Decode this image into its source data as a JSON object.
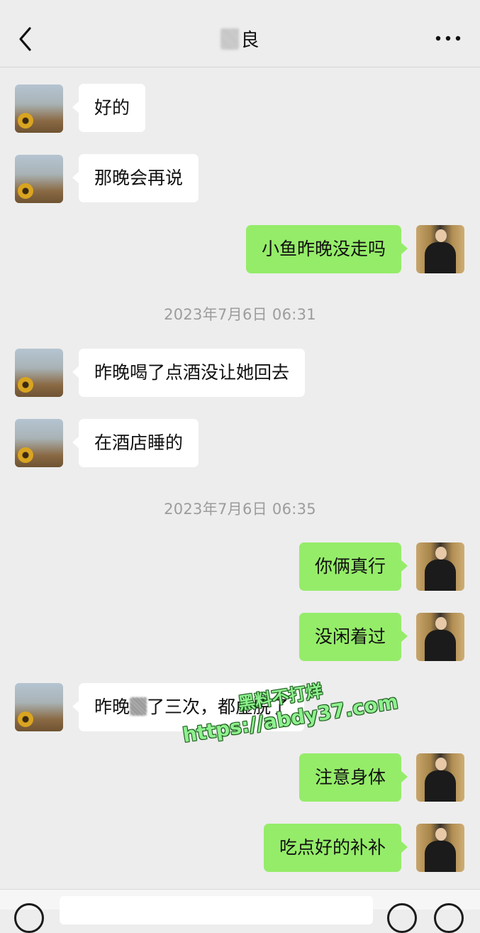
{
  "header": {
    "back_icon": "chevron-left-icon",
    "title": "良",
    "more_icon": "more-dots-icon"
  },
  "messages": [
    {
      "from": "other",
      "text": "好的"
    },
    {
      "from": "other",
      "text": "那晚会再说"
    },
    {
      "from": "self",
      "text": "小鱼昨晚没走吗"
    },
    {
      "type": "time",
      "text": "2023年7月6日 06:31"
    },
    {
      "from": "other",
      "text": "昨晚喝了点酒没让她回去"
    },
    {
      "from": "other",
      "text": "在酒店睡的"
    },
    {
      "type": "time",
      "text": "2023年7月6日 06:35"
    },
    {
      "from": "self",
      "text": "你俩真行"
    },
    {
      "from": "self",
      "text": "没闲着过"
    },
    {
      "from": "other",
      "text_before": "昨晚",
      "text_after": "了三次，都虚脱了"
    },
    {
      "from": "self",
      "text": "注意身体"
    },
    {
      "from": "self",
      "text": "吃点好的补补"
    }
  ],
  "watermark": {
    "line1": "黑料不打烊",
    "line2": "https://abdy37.com"
  },
  "colors": {
    "background": "#ededed",
    "self_bubble": "#95ec69",
    "other_bubble": "#ffffff",
    "timestamp": "#9c9c9c"
  },
  "input_bar": {
    "voice_icon": "voice-icon",
    "emoji_icon": "emoji-icon",
    "plus_icon": "plus-icon"
  }
}
